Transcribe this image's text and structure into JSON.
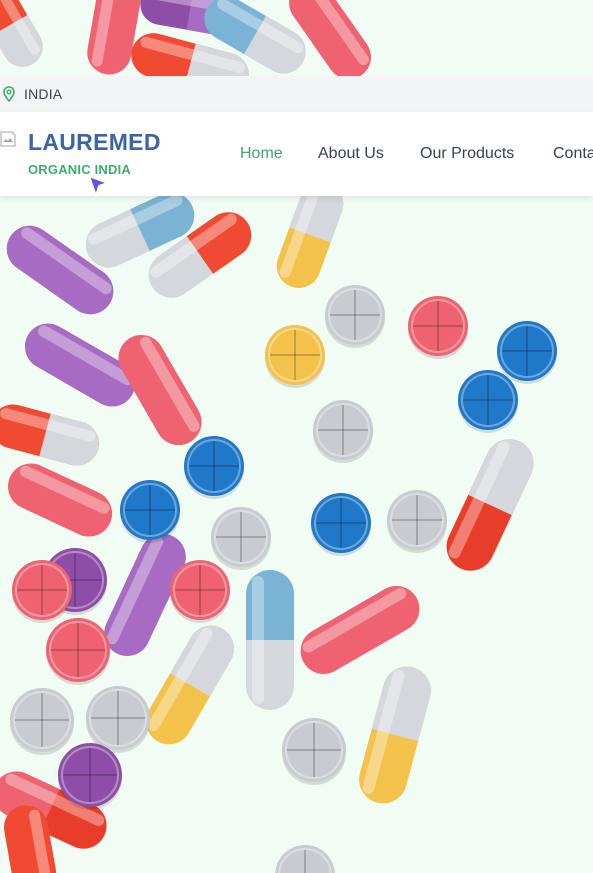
{
  "topbar": {
    "country": "INDIA"
  },
  "brand": {
    "name": "LAUREMED",
    "tagline": "ORGANIC INDIA"
  },
  "nav": {
    "home": "Home",
    "about": "About Us",
    "products": "Our Products",
    "contact": "Conta"
  },
  "icons": {
    "location": "map-pin-icon",
    "logo": "broken-image-icon",
    "cursor": "pointer-cursor-icon"
  },
  "colors": {
    "brand": "#3a66a8",
    "accent": "#3cae6c",
    "nav_active": "#3fa56a",
    "hero_bg": "#f1fcf4"
  }
}
